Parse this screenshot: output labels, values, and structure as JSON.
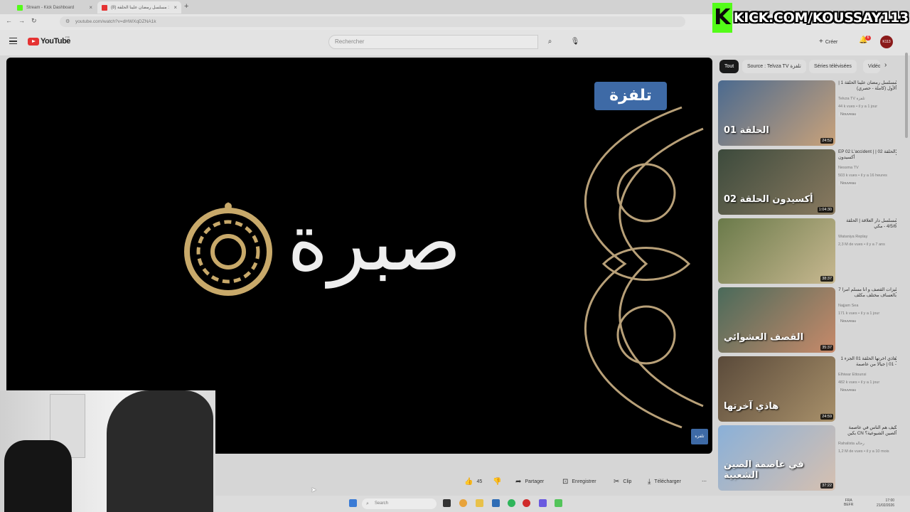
{
  "browser": {
    "tabs": [
      {
        "title": "Stream - Kick Dashboard",
        "favicon_color": "#53fc18"
      },
      {
        "title": "(8) مسلسل رمضان علينا الحلقة :",
        "favicon_color": "#e53333"
      }
    ],
    "url": "youtube.com/watch?v=dHWXqDZNA1k",
    "nav": {
      "back": "←",
      "forward": "→",
      "reload": "↻"
    }
  },
  "youtube": {
    "wordmark": "YouTube",
    "region": "FR",
    "search_placeholder": "Rechercher",
    "create_label": "Créer",
    "notifications_count": "6",
    "avatar_initials": "K113"
  },
  "overlay": {
    "kick_logo_letter": "K",
    "kick_url": "KICK.COM/KOUSSAY113"
  },
  "video": {
    "watermark_text": "تلفزة",
    "corner_logo_text": "تلفزة",
    "title_card_text": "صبرة"
  },
  "actions": {
    "like_count": "45",
    "share_label": "Partager",
    "save_label": "Enregistrer",
    "clip_label": "Clip",
    "download_label": "Télécharger",
    "more": "⋯"
  },
  "chips": [
    {
      "label": "Tout",
      "active": true
    },
    {
      "label": "Source : Telvza TV تلفزة",
      "active": false
    },
    {
      "label": "Séries télévisées",
      "active": false
    },
    {
      "label": "Vidéos",
      "active": false
    }
  ],
  "recommendations": [
    {
      "title": "مسلسل رمضان علينا الحلقة 1 | الأول (كاملة - حصري)",
      "channel": "Telvza TV تلفزة",
      "meta": "44 k vues • il y a 1 jour",
      "badge": "Nouveau",
      "duration": "24:52",
      "thumb_text": "الحلقة 01",
      "thumb_colors": [
        "#4b6a8f",
        "#c9a27a"
      ]
    },
    {
      "title": "EP 02 L'accident | الحلقة 02 | أكسيدون",
      "channel": "Nessma TV",
      "meta": "503 k vues • il y a 16 heures",
      "badge": "Nouveau",
      "duration": "1:04:30",
      "thumb_text": "أكسيدون الحلقة 02",
      "thumb_colors": [
        "#3c4a3c",
        "#8a7a60"
      ]
    },
    {
      "title": "مسلسل دار العلاقة | الحلقة 4/5/6 - مكي",
      "channel": "Wataniya Replay",
      "meta": "2,3 M de vues • il y a 7 ans",
      "badge": "",
      "duration": "38:37",
      "thumb_text": "",
      "thumb_colors": [
        "#6a7a4a",
        "#c8b890"
      ]
    },
    {
      "title": "تيزات القصف و أنا مسلم أمرا 7 بالعساف مختلف مكلف",
      "channel": "Najjam Sea",
      "meta": "171 k vues • il y a 1 jour",
      "badge": "Nouveau",
      "duration": "35:37",
      "thumb_text": "القصف العشوائي",
      "thumb_colors": [
        "#4a6a5a",
        "#c88a6a"
      ]
    },
    {
      "title": "هاذي آخرتها الحلقة 01 الجزء 1 - 01 | جيالا من عاصمة",
      "channel": "Elhiwar Ettounsi",
      "meta": "482 k vues • il y a 1 jour",
      "badge": "Nouveau",
      "duration": "24:59",
      "thumb_text": "هاذي آخرتها",
      "thumb_colors": [
        "#5a4a3a",
        "#a8906a"
      ]
    },
    {
      "title": "كيف هم الناس في عاصمة الصين الشيوعية؟ CN بكين",
      "channel": "Rahalista رحالة",
      "meta": "1,2 M de vues • il y a 10 mois",
      "badge": "",
      "duration": "37:22",
      "thumb_text": "في عاصمة الصين الشعبية",
      "thumb_colors": [
        "#8ab0d8",
        "#d6c0b0"
      ]
    }
  ],
  "taskbar": {
    "search_placeholder": "Search",
    "lang": "FRA",
    "lang_sub": "BEFR",
    "time": "17:00",
    "date": "21/02/2026"
  },
  "colors": {
    "kick_green": "#53fc18",
    "youtube_red": "#e53333",
    "telvza_blue": "#3e6aa6"
  }
}
